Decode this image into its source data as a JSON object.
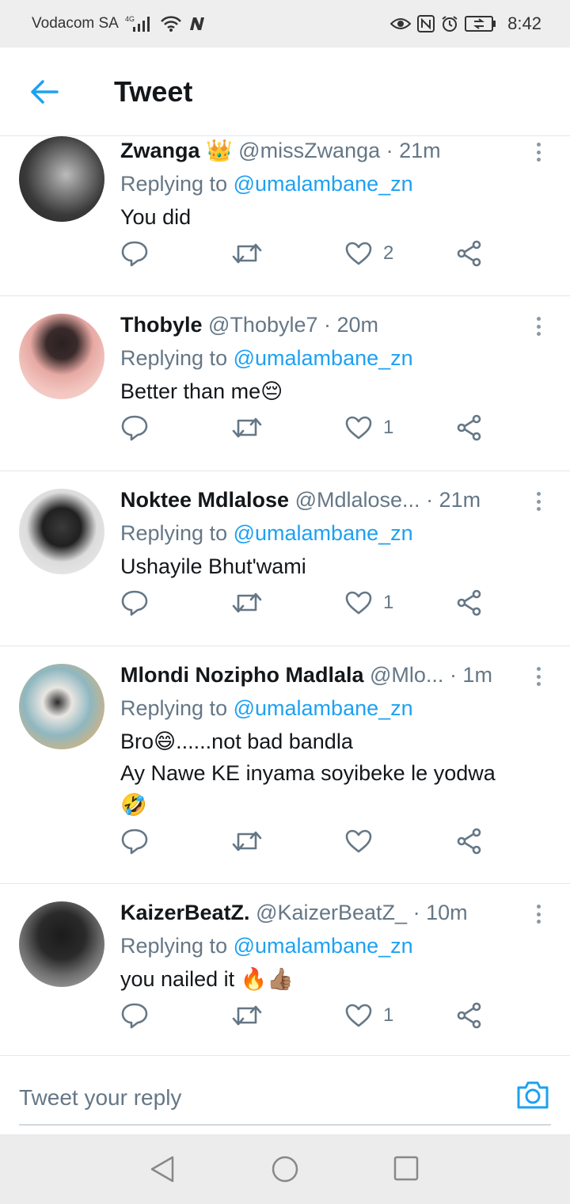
{
  "status_bar": {
    "carrier": "Vodacom SA",
    "network": "4G",
    "time": "8:42"
  },
  "header": {
    "title": "Tweet"
  },
  "tweets": [
    {
      "name": "Zwanga",
      "name_emoji": "👑",
      "handle": "@missZwanga",
      "time": "· 21m",
      "replying_prefix": "Replying to",
      "replying_to": "@umalambane_zn",
      "lines": [
        "You did"
      ],
      "likes": "2"
    },
    {
      "name": "Thobyle",
      "name_emoji": "",
      "handle": "@Thobyle7",
      "time": "· 20m",
      "replying_prefix": "Replying to",
      "replying_to": "@umalambane_zn",
      "lines": [
        "Better than me😔"
      ],
      "likes": "1"
    },
    {
      "name": "Noktee Mdlalose",
      "name_emoji": "",
      "handle": "@Mdlalose...",
      "time": "· 21m",
      "replying_prefix": "Replying to",
      "replying_to": "@umalambane_zn",
      "lines": [
        "Ushayile Bhut'wami"
      ],
      "likes": "1"
    },
    {
      "name": "Mlondi Nozipho Madlala",
      "name_emoji": "",
      "handle": "@Mlo...",
      "time": "· 1m",
      "replying_prefix": "Replying to",
      "replying_to": "@umalambane_zn",
      "lines": [
        "Bro😄......not bad bandla",
        "Ay Nawe KE inyama soyibeke le yodwa",
        "🤣"
      ],
      "likes": ""
    },
    {
      "name": "KaizerBeatZ.",
      "name_emoji": "",
      "handle": "@KaizerBeatZ_",
      "time": "· 10m",
      "replying_prefix": "Replying to",
      "replying_to": "@umalambane_zn",
      "lines": [
        "you nailed it 🔥👍🏽"
      ],
      "likes": "1"
    }
  ],
  "composer": {
    "placeholder": "Tweet your reply"
  },
  "colors": {
    "accent": "#1da1f2",
    "secondary_text": "#657786",
    "divider": "#e1e8ed"
  }
}
